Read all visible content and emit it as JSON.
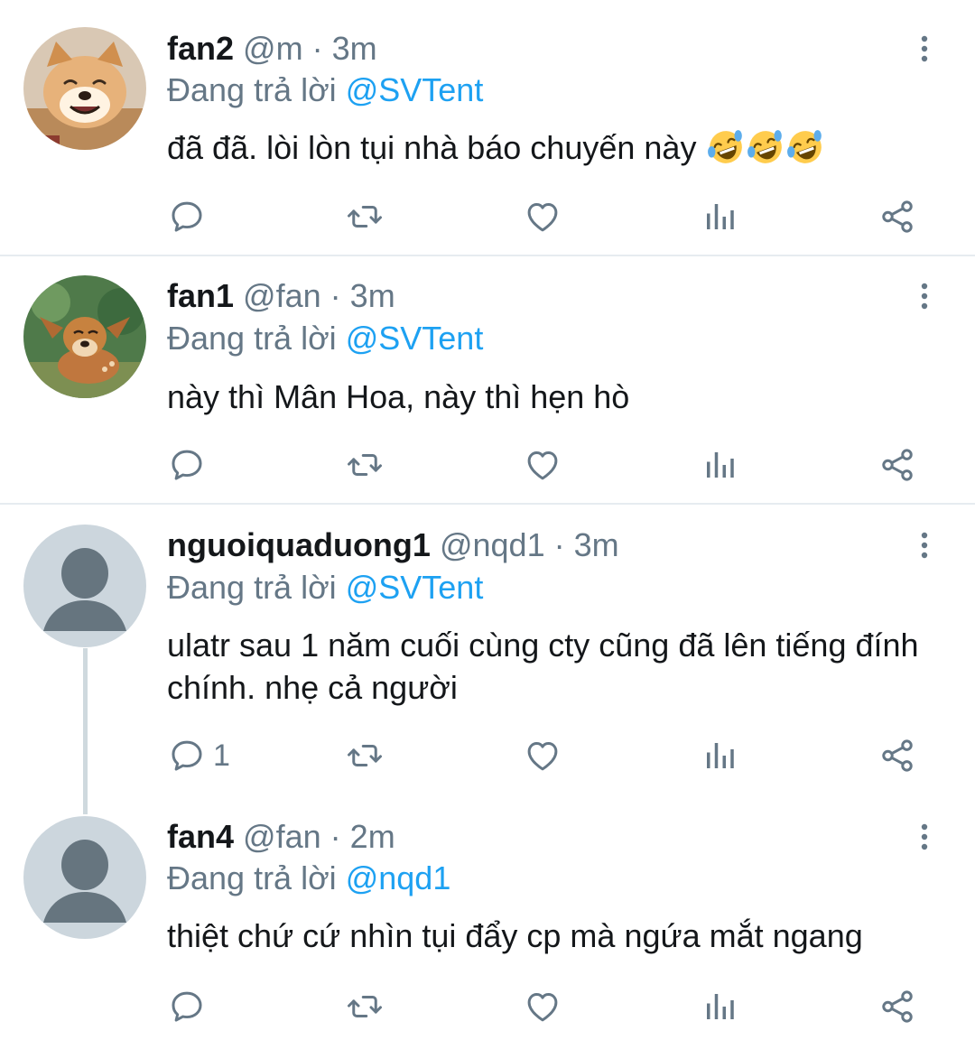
{
  "colors": {
    "accent": "#1da1f2",
    "muted": "#657786",
    "divider": "#e6ecf0",
    "text": "#14171a"
  },
  "tweets": [
    {
      "name": "fan2",
      "handle": "@m",
      "separator": "·",
      "time": "3m",
      "reply_prefix": "Đang trả lời",
      "reply_to": "@SVTent",
      "text": "đã đã. lòi lòn tụi nhà báo chuyến này",
      "emoji": [
        "rolling-on-floor-laughing",
        "rolling-on-floor-laughing",
        "rolling-on-floor-laughing"
      ],
      "avatar": "shiba-dog-avatar",
      "reply_count": ""
    },
    {
      "name": "fan1",
      "handle": "@fan",
      "separator": "·",
      "time": "3m",
      "reply_prefix": "Đang trả lời",
      "reply_to": "@SVTent",
      "text": "này thì Mân Hoa, này thì hẹn hò",
      "avatar": "bambi-fawn-avatar",
      "reply_count": ""
    },
    {
      "name": "nguoiquaduong1",
      "handle": "@nqd1",
      "separator": "·",
      "time": "3m",
      "reply_prefix": "Đang trả lời",
      "reply_to": "@SVTent",
      "text": "ulatr sau 1 năm cuối cùng cty cũng đã lên tiếng đính chính. nhẹ cả người",
      "avatar": "default-user-avatar",
      "reply_count": "1"
    },
    {
      "name": "fan4",
      "handle": "@fan",
      "separator": "·",
      "time": "2m",
      "reply_prefix": "Đang trả lời",
      "reply_to": "@nqd1",
      "text": "thiệt chứ cứ nhìn tụi đẩy cp mà ngứa mắt ngang",
      "avatar": "default-user-avatar",
      "reply_count": ""
    }
  ],
  "action_icons": [
    "reply-icon",
    "retweet-icon",
    "like-icon",
    "analytics-icon",
    "share-icon"
  ]
}
